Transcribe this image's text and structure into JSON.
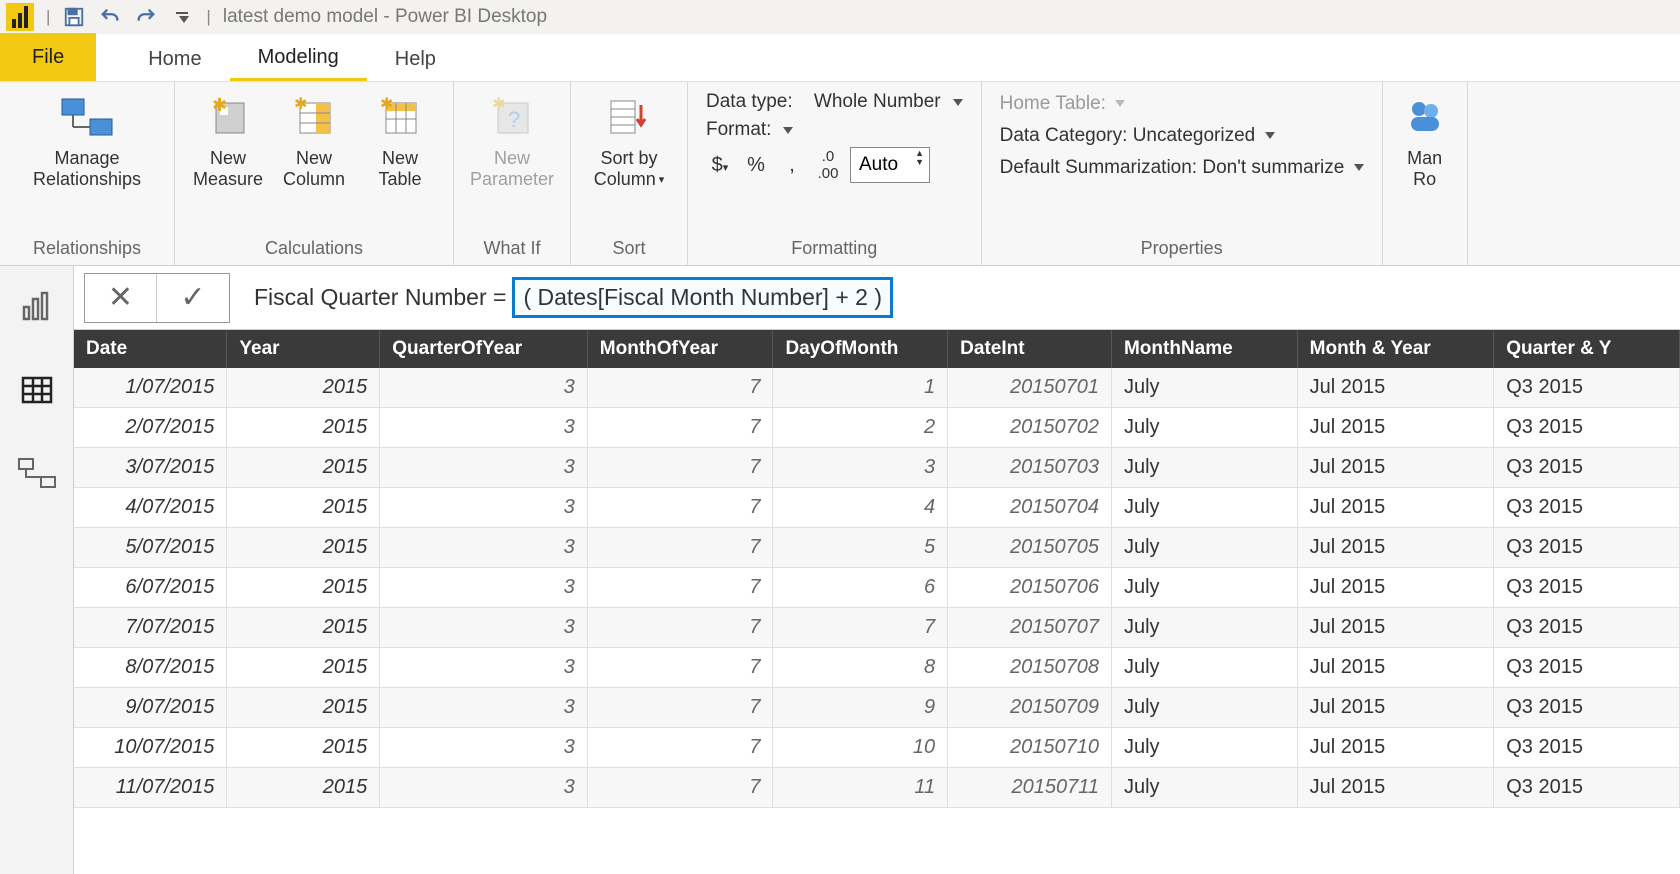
{
  "titlebar": {
    "title_doc": "latest demo model",
    "title_app": "Power BI Desktop"
  },
  "tabs": {
    "file": "File",
    "home": "Home",
    "modeling": "Modeling",
    "help": "Help"
  },
  "ribbon": {
    "manage_rel_l1": "Manage",
    "manage_rel_l2": "Relationships",
    "new_measure_l1": "New",
    "new_measure_l2": "Measure",
    "new_column_l1": "New",
    "new_column_l2": "Column",
    "new_table_l1": "New",
    "new_table_l2": "Table",
    "new_param_l1": "New",
    "new_param_l2": "Parameter",
    "sort_by_l1": "Sort by",
    "sort_by_l2": "Column",
    "data_type_label": "Data type:",
    "data_type_value": "Whole Number",
    "format_label": "Format:",
    "auto_text": "Auto",
    "home_table_label": "Home Table:",
    "data_category_label": "Data Category:",
    "data_category_value": "Uncategorized",
    "default_summ_label": "Default Summarization:",
    "default_summ_value": "Don't summarize",
    "manage_roles_l1": "Man",
    "manage_roles_l2": "Ro",
    "group_relationships": "Relationships",
    "group_calculations": "Calculations",
    "group_what_if": "What If",
    "group_sort": "Sort",
    "group_formatting": "Formatting",
    "group_properties": "Properties"
  },
  "formula": {
    "lhs": "Fiscal Quarter Number = ",
    "rhs": "( Dates[Fiscal Month Number] + 2 )"
  },
  "table": {
    "headers": [
      "Date",
      "Year",
      "QuarterOfYear",
      "MonthOfYear",
      "DayOfMonth",
      "DateInt",
      "MonthName",
      "Month & Year",
      "Quarter & Y"
    ],
    "rows": [
      [
        "1/07/2015",
        "2015",
        "3",
        "7",
        "1",
        "20150701",
        "July",
        "Jul 2015",
        "Q3 2015"
      ],
      [
        "2/07/2015",
        "2015",
        "3",
        "7",
        "2",
        "20150702",
        "July",
        "Jul 2015",
        "Q3 2015"
      ],
      [
        "3/07/2015",
        "2015",
        "3",
        "7",
        "3",
        "20150703",
        "July",
        "Jul 2015",
        "Q3 2015"
      ],
      [
        "4/07/2015",
        "2015",
        "3",
        "7",
        "4",
        "20150704",
        "July",
        "Jul 2015",
        "Q3 2015"
      ],
      [
        "5/07/2015",
        "2015",
        "3",
        "7",
        "5",
        "20150705",
        "July",
        "Jul 2015",
        "Q3 2015"
      ],
      [
        "6/07/2015",
        "2015",
        "3",
        "7",
        "6",
        "20150706",
        "July",
        "Jul 2015",
        "Q3 2015"
      ],
      [
        "7/07/2015",
        "2015",
        "3",
        "7",
        "7",
        "20150707",
        "July",
        "Jul 2015",
        "Q3 2015"
      ],
      [
        "8/07/2015",
        "2015",
        "3",
        "7",
        "8",
        "20150708",
        "July",
        "Jul 2015",
        "Q3 2015"
      ],
      [
        "9/07/2015",
        "2015",
        "3",
        "7",
        "9",
        "20150709",
        "July",
        "Jul 2015",
        "Q3 2015"
      ],
      [
        "10/07/2015",
        "2015",
        "3",
        "7",
        "10",
        "20150710",
        "July",
        "Jul 2015",
        "Q3 2015"
      ],
      [
        "11/07/2015",
        "2015",
        "3",
        "7",
        "11",
        "20150711",
        "July",
        "Jul 2015",
        "Q3 2015"
      ]
    ],
    "numeric_cols": [
      0,
      1,
      2,
      3,
      4,
      5
    ],
    "text_cols": [
      6,
      7,
      8
    ]
  }
}
